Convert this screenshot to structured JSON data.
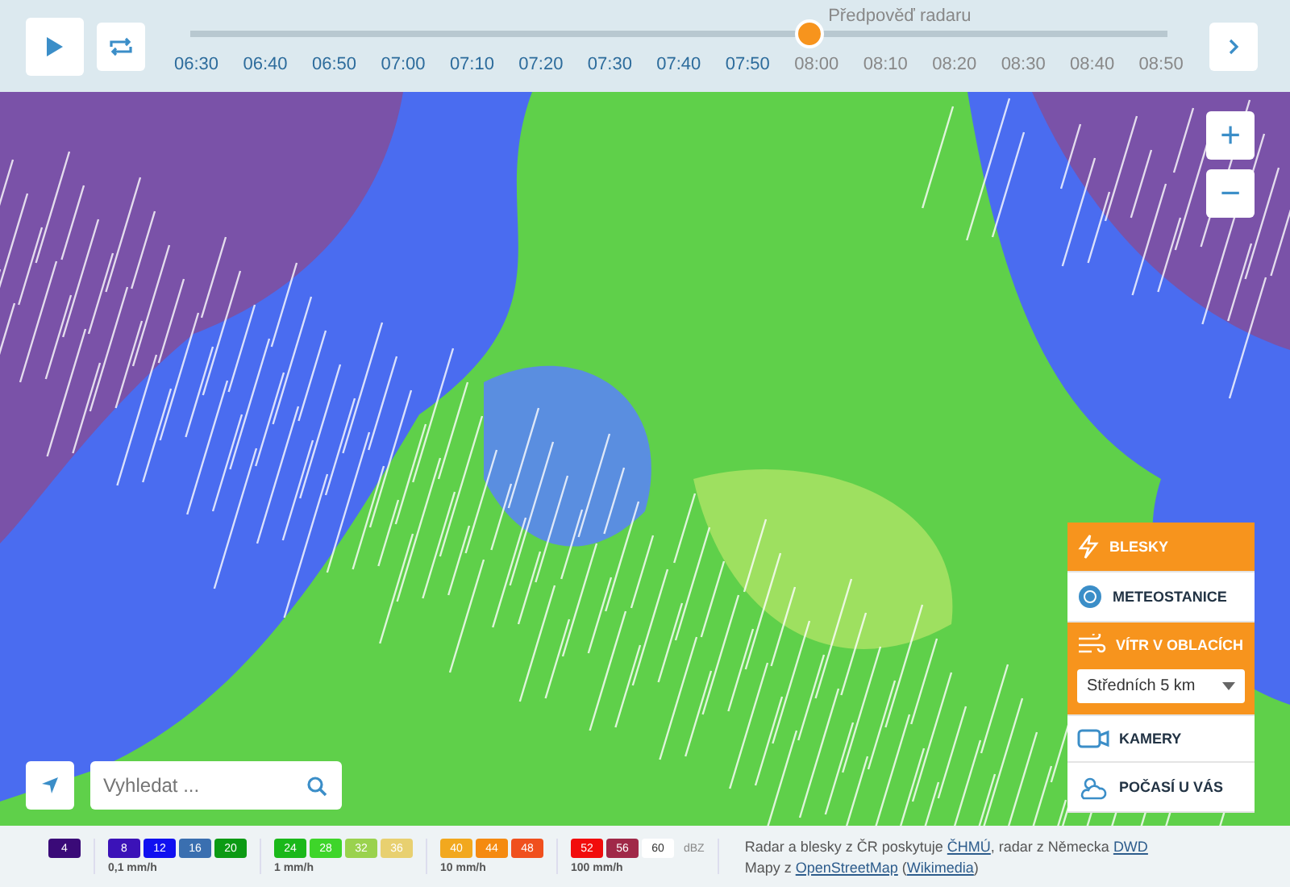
{
  "timeline": {
    "forecast_label": "Předpověď radaru",
    "level": 0.633,
    "times": [
      {
        "label": "06:30",
        "forecast": false
      },
      {
        "label": "06:40",
        "forecast": false
      },
      {
        "label": "06:50",
        "forecast": false
      },
      {
        "label": "07:00",
        "forecast": false
      },
      {
        "label": "07:10",
        "forecast": false
      },
      {
        "label": "07:20",
        "forecast": false
      },
      {
        "label": "07:30",
        "forecast": false
      },
      {
        "label": "07:40",
        "forecast": false
      },
      {
        "label": "07:50",
        "forecast": false
      },
      {
        "label": "08:00",
        "forecast": true
      },
      {
        "label": "08:10",
        "forecast": true
      },
      {
        "label": "08:20",
        "forecast": true
      },
      {
        "label": "08:30",
        "forecast": true
      },
      {
        "label": "08:40",
        "forecast": true
      },
      {
        "label": "08:50",
        "forecast": true
      }
    ]
  },
  "zoom": {
    "in": "+",
    "out": "−"
  },
  "search": {
    "placeholder": "Vyhledat ..."
  },
  "layers": [
    {
      "kind": "toggle",
      "label": "BLESKY",
      "on": true
    },
    {
      "kind": "toggle",
      "label": "METEOSTANICE",
      "on": false
    },
    {
      "kind": "toggle",
      "label": "VÍTR V OBLACÍCH",
      "on": true,
      "select": "Středních 5 km"
    },
    {
      "kind": "toggle",
      "label": "KAMERY",
      "on": false
    },
    {
      "kind": "toggle",
      "label": "POČASÍ U VÁS",
      "on": false
    }
  ],
  "legend": {
    "unit": "dBZ",
    "groups": [
      {
        "steps": [
          {
            "value": "4",
            "color": "#3a0a78"
          }
        ]
      },
      {
        "label": "0,1 mm/h",
        "steps": [
          {
            "value": "8",
            "color": "#3b12b8"
          },
          {
            "value": "12",
            "color": "#1010f0"
          },
          {
            "value": "16",
            "color": "#3a6fb0"
          },
          {
            "value": "20",
            "color": "#0c9a14"
          }
        ]
      },
      {
        "label": "1 mm/h",
        "steps": [
          {
            "value": "24",
            "color": "#1ab81a"
          },
          {
            "value": "28",
            "color": "#3ed52a"
          },
          {
            "value": "32",
            "color": "#9ad24e"
          },
          {
            "value": "36",
            "color": "#e8d070"
          }
        ]
      },
      {
        "label": "10 mm/h",
        "steps": [
          {
            "value": "40",
            "color": "#f2a81e"
          },
          {
            "value": "44",
            "color": "#f58a10"
          },
          {
            "value": "48",
            "color": "#f0501e"
          }
        ]
      },
      {
        "label": "100 mm/h",
        "steps": [
          {
            "value": "52",
            "color": "#f20c0c"
          },
          {
            "value": "56",
            "color": "#a02848"
          },
          {
            "value": "60",
            "color": "#ffffff"
          }
        ]
      }
    ]
  },
  "credits": {
    "line1": "Radar a blesky z ČR poskytuje ",
    "link1": "ČHMÚ",
    "mid1": ", radar z Německa ",
    "link2": "DWD",
    "line2": "Mapy z ",
    "link3": "OpenStreetMap",
    "mid2": " (",
    "link4": "Wikimedia",
    "end2": ")"
  }
}
